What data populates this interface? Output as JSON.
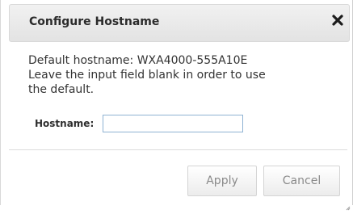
{
  "dialog": {
    "title": "Configure Hostname",
    "close_icon": "close-icon",
    "message_lines": [
      "Default hostname: WXA4000-555A10E",
      "Leave the input field blank in order to use",
      "the default."
    ],
    "hostname_label": "Hostname:",
    "hostname_value": "",
    "apply_label": "Apply",
    "cancel_label": "Cancel"
  },
  "colors": {
    "title_text": "#2b2b2b",
    "body_text": "#333333",
    "input_border": "#8fb3d3",
    "button_text": "#8a8a8a"
  }
}
